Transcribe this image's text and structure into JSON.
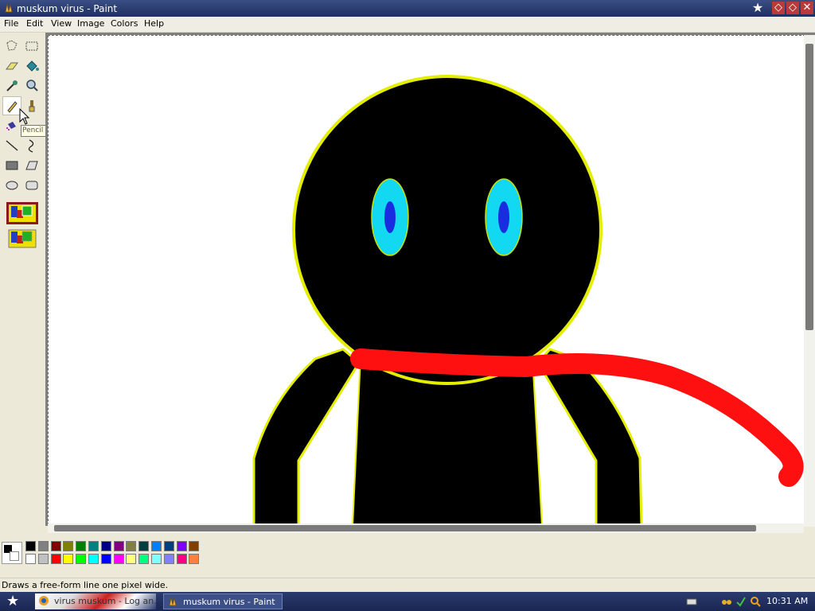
{
  "window": {
    "title": "muskum virus - Paint",
    "controls": {
      "star": "★",
      "minimize": "◇",
      "maximize": "◇",
      "close": "✕"
    }
  },
  "menu": [
    "File",
    "Edit",
    "View",
    "Image",
    "Colors",
    "Help"
  ],
  "tools": {
    "items": [
      "free-form-select",
      "select",
      "eraser",
      "fill-with-color",
      "pick-color",
      "magnifier",
      "pencil",
      "brush",
      "airbrush",
      "text",
      "line",
      "curve",
      "rectangle",
      "polygon",
      "ellipse",
      "rounded-rectangle"
    ],
    "selected": "pencil",
    "tooltip": "Pencil"
  },
  "palette": {
    "foreground": "#000000",
    "background": "#ffffff",
    "row1": [
      "#000000",
      "#808080",
      "#800000",
      "#808000",
      "#008000",
      "#008080",
      "#000080",
      "#800080",
      "#808040",
      "#004040",
      "#0080ff",
      "#004080",
      "#8000ff",
      "#804000"
    ],
    "row2": [
      "#ffffff",
      "#c0c0c0",
      "#ff0000",
      "#ffff00",
      "#00ff00",
      "#00ffff",
      "#0000ff",
      "#ff00ff",
      "#ffff80",
      "#00ff80",
      "#80ffff",
      "#8080ff",
      "#ff0080",
      "#ff8040"
    ]
  },
  "status": {
    "text": "Draws a free-form line one pixel wide."
  },
  "taskbar": {
    "start_icon": "★",
    "buttons": [
      {
        "label": "virus muskum - Log an..."
      },
      {
        "label": "muskum virus - Paint"
      }
    ],
    "clock": "10:31 AM"
  }
}
